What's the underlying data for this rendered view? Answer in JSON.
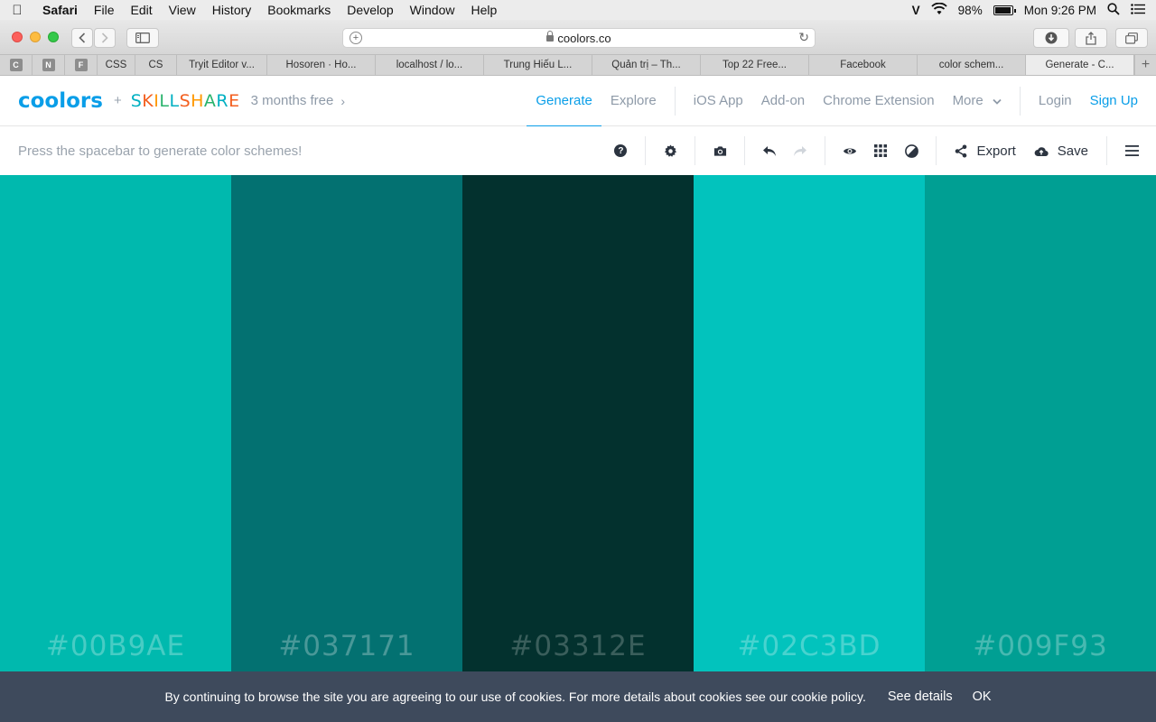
{
  "macos": {
    "app_name": "Safari",
    "menu": [
      "File",
      "Edit",
      "View",
      "History",
      "Bookmarks",
      "Develop",
      "Window",
      "Help"
    ],
    "status": {
      "user_initial": "V",
      "battery": "98%",
      "clock": "Mon 9:26 PM"
    }
  },
  "browser": {
    "url": "coolors.co",
    "tabs": [
      {
        "label": "C",
        "type": "favicon"
      },
      {
        "label": "N",
        "type": "favicon"
      },
      {
        "label": "F",
        "type": "favicon"
      },
      {
        "label": "CSS",
        "type": "tab"
      },
      {
        "label": "CS",
        "type": "tab"
      },
      {
        "label": "Tryit Editor v...",
        "type": "tab"
      },
      {
        "label": "Hosoren · Ho...",
        "type": "tab"
      },
      {
        "label": "localhost / lo...",
        "type": "tab"
      },
      {
        "label": "Trung Hiếu L...",
        "type": "tab"
      },
      {
        "label": "Quản trị – Th...",
        "type": "tab"
      },
      {
        "label": "Top 22 Free...",
        "type": "tab"
      },
      {
        "label": "Facebook",
        "type": "tab"
      },
      {
        "label": "color schem...",
        "type": "tab"
      },
      {
        "label": "Generate - C...",
        "type": "tab",
        "active": true
      }
    ],
    "new_tab": "+"
  },
  "site": {
    "logo": "coolors",
    "plus": "+",
    "partner": "SKILLSHARE",
    "partner_colors": [
      "#00b0c2",
      "#f35f1f",
      "#ff9800",
      "#29b36c"
    ],
    "promo": "3 months free",
    "nav": {
      "generate": "Generate",
      "explore": "Explore",
      "ios_app": "iOS App",
      "addon": "Add-on",
      "chrome_ext": "Chrome Extension",
      "more": "More",
      "login": "Login",
      "signup": "Sign Up"
    },
    "accent": "#0a9ee8"
  },
  "generator": {
    "hint": "Press the spacebar to generate color schemes!",
    "export": "Export",
    "save": "Save"
  },
  "palette": [
    {
      "hex": "#00B9AE",
      "color": "#00b9ae"
    },
    {
      "hex": "#037171",
      "color": "#037171"
    },
    {
      "hex": "#03312E",
      "color": "#03312e"
    },
    {
      "hex": "#02C3BD",
      "color": "#02c3bd"
    },
    {
      "hex": "#009F93",
      "color": "#009f93"
    }
  ],
  "cookie": {
    "message": "By continuing to browse the site you are agreeing to our use of cookies. For more details about cookies see our cookie policy.",
    "details": "See details",
    "ok": "OK"
  }
}
